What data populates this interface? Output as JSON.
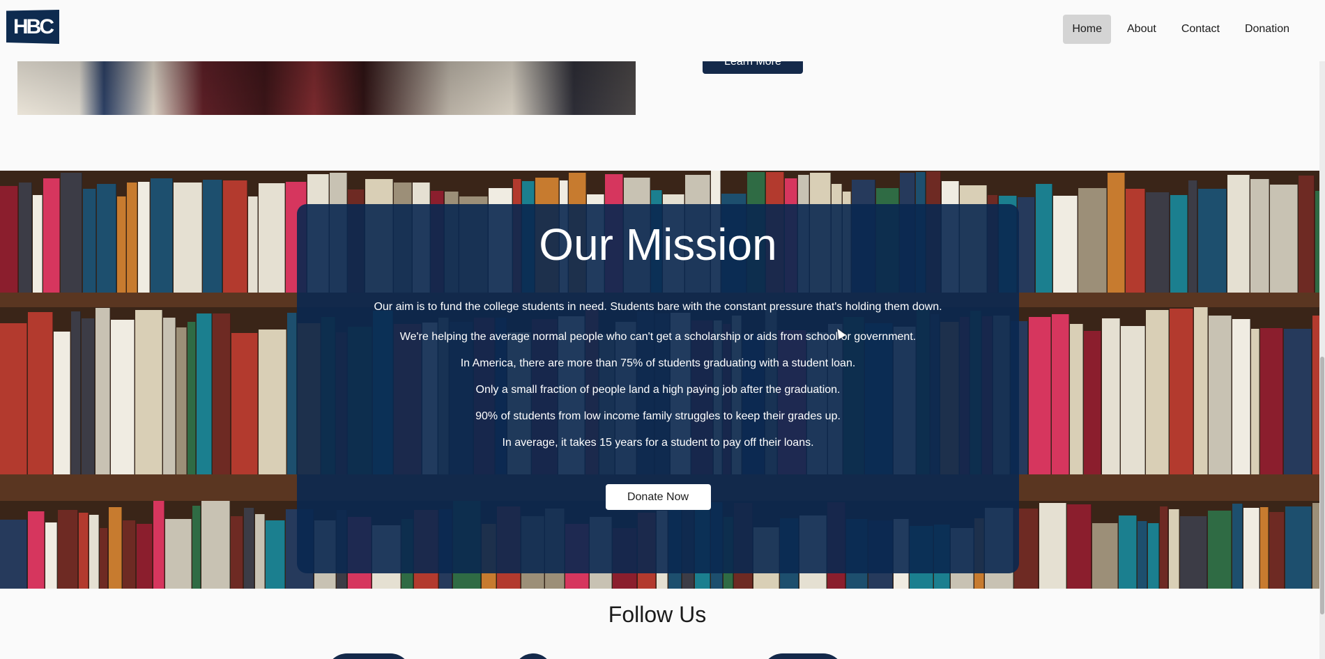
{
  "header": {
    "logo_text": "HBC",
    "nav": [
      {
        "label": "Home",
        "active": true
      },
      {
        "label": "About",
        "active": false
      },
      {
        "label": "Contact",
        "active": false
      },
      {
        "label": "Donation",
        "active": false
      }
    ]
  },
  "top_section": {
    "learn_more_label": "Learn More"
  },
  "mission": {
    "title": "Our Mission",
    "lines": [
      "Our aim is to fund the college students in need. Students bare with the constant pressure that's holding them down.",
      "We're helping the average normal people who can't get a scholarship or aids from school or government.",
      "In America, there are more than 75% of students graduating with a student loan.",
      "Only a small fraction of people land a high paying job after the graduation.",
      "90% of students from low income family struggles to keep their grades up.",
      "In average, it takes 15 years for a student to pay off their loans."
    ],
    "donate_label": "Donate Now"
  },
  "follow": {
    "title": "Follow Us"
  },
  "colors": {
    "brand_navy": "#0e2b4f",
    "card_overlay": "#0a2850",
    "nav_active_bg": "#d4d4d4",
    "page_bg": "#fafafa"
  }
}
